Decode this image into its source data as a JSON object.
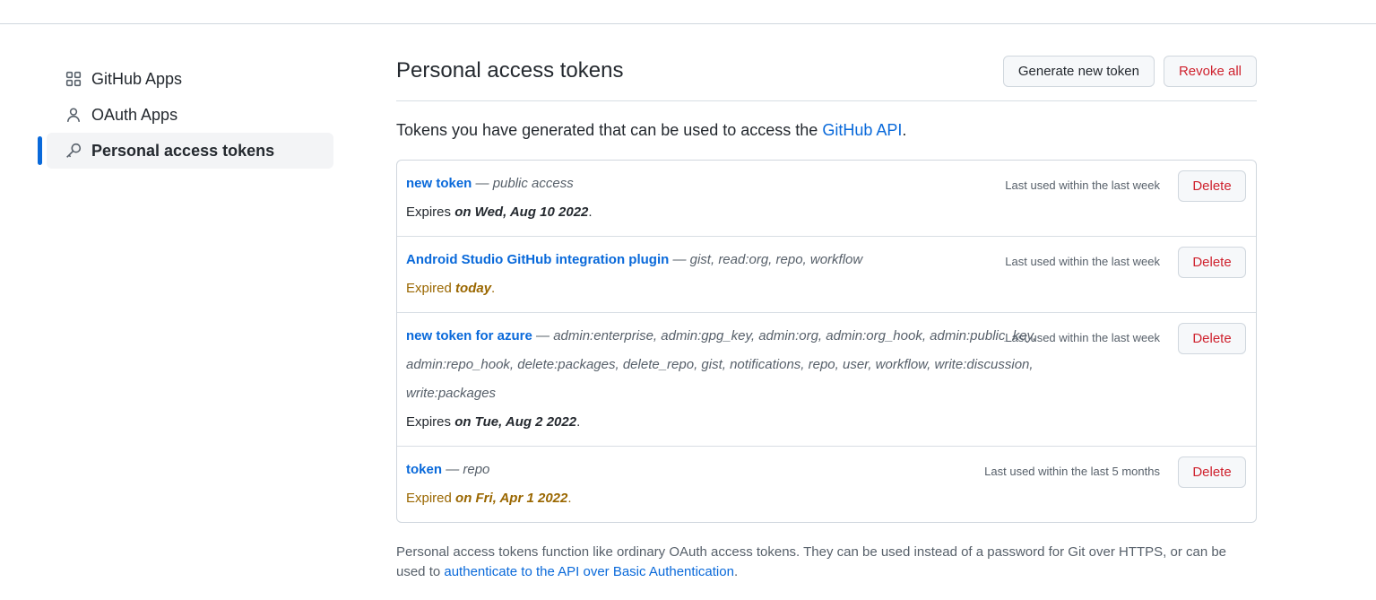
{
  "sidebar": {
    "items": [
      {
        "label": "GitHub Apps",
        "icon": "apps-grid-icon"
      },
      {
        "label": "OAuth Apps",
        "icon": "person-icon"
      },
      {
        "label": "Personal access tokens",
        "icon": "key-icon",
        "active": true
      }
    ]
  },
  "header": {
    "title": "Personal access tokens",
    "generate_label": "Generate new token",
    "revoke_label": "Revoke all"
  },
  "intro": {
    "text": "Tokens you have generated that can be used to access the ",
    "link": "GitHub API",
    "suffix": "."
  },
  "tokens": [
    {
      "name": "new token",
      "scopes": "— public access",
      "expiry_prefix": "Expires ",
      "expiry_date": "on Wed, Aug 10 2022",
      "expiry_suffix": ".",
      "last_used": "Last used within the last week",
      "delete_label": "Delete"
    },
    {
      "name": "Android Studio GitHub integration plugin",
      "scopes": "— gist, read:org, repo, workflow",
      "expiry_prefix": "Expired ",
      "expiry_date": "today",
      "expiry_suffix": ".",
      "last_used": "Last used within the last week",
      "delete_label": "Delete"
    },
    {
      "name": "new token for azure",
      "scopes": "— admin:enterprise, admin:gpg_key, admin:org, admin:org_hook, admin:public_key, admin:repo_hook, delete:packages, delete_repo, gist, notifications, repo, user, workflow, write:discussion, write:packages",
      "expiry_prefix": "Expires ",
      "expiry_date": "on Tue, Aug 2 2022",
      "expiry_suffix": ".",
      "last_used": "Last used within the last week",
      "delete_label": "Delete"
    },
    {
      "name": "token",
      "scopes": "— repo",
      "expiry_prefix": "Expired ",
      "expiry_date": "on Fri, Apr 1 2022",
      "expiry_suffix": ".",
      "last_used": "Last used within the last 5 months",
      "delete_label": "Delete"
    }
  ],
  "footer": {
    "text": "Personal access tokens function like ordinary OAuth access tokens. They can be used instead of a password for Git over HTTPS, or can be used to ",
    "link": "authenticate to the API over Basic Authentication",
    "suffix": "."
  },
  "colors": {
    "link": "#0969da",
    "danger": "#cf222e",
    "expired": "#9a6700",
    "active_bar": "#0969da"
  }
}
